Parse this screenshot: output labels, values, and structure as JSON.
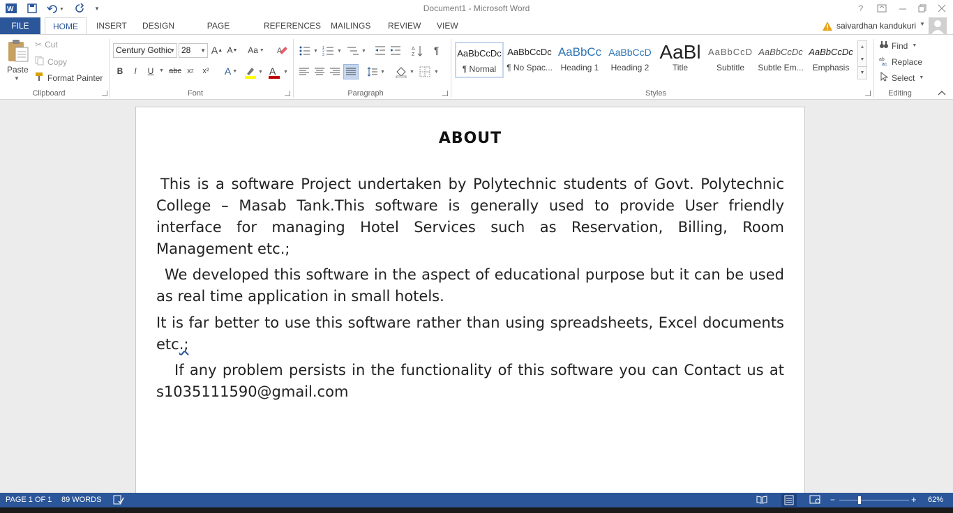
{
  "window": {
    "title": "Document1 - Microsoft Word",
    "user_name": "saivardhan kandukuri",
    "help_label": "?"
  },
  "tabs": {
    "file": "FILE",
    "items": [
      "HOME",
      "INSERT",
      "DESIGN",
      "PAGE LAYOUT",
      "REFERENCES",
      "MAILINGS",
      "REVIEW",
      "VIEW"
    ]
  },
  "clipboard": {
    "paste": "Paste",
    "cut": "Cut",
    "copy": "Copy",
    "format_painter": "Format Painter",
    "group_label": "Clipboard"
  },
  "font": {
    "family": "Century Gothic",
    "size": "28",
    "group_label": "Font",
    "bold": "B",
    "italic": "I",
    "underline": "U",
    "strike": "abc",
    "superscript": "x²",
    "text_effects": "A",
    "font_color": "A",
    "grow": "A",
    "shrink": "A",
    "change_case": "Aa",
    "highlight_color": "#ffff00",
    "font_color_value": "#c00000"
  },
  "paragraph": {
    "group_label": "Paragraph"
  },
  "styles": {
    "group_label": "Styles",
    "items": [
      {
        "sample": "AaBbCcDc",
        "name": "¶ Normal"
      },
      {
        "sample": "AaBbCcDc",
        "name": "¶ No Spac..."
      },
      {
        "sample": "AaBbCc",
        "name": "Heading 1"
      },
      {
        "sample": "AaBbCcD",
        "name": "Heading 2"
      },
      {
        "sample": "AaBl",
        "name": "Title"
      },
      {
        "sample": "AaBbCcD",
        "name": "Subtitle"
      },
      {
        "sample": "AaBbCcDc",
        "name": "Subtle Em..."
      },
      {
        "sample": "AaBbCcDc",
        "name": "Emphasis"
      }
    ]
  },
  "editing": {
    "group_label": "Editing",
    "find": "Find",
    "replace": "Replace",
    "select": "Select"
  },
  "document": {
    "title": "ABOUT",
    "paragraphs": [
      "  This is a software Project undertaken by Polytechnic students of Govt. Polytechnic College – Masab Tank.This software is generally used to provide User friendly interface for managing Hotel Services such as Reservation, Billing, Room Management etc.;",
      " We developed this software in the aspect of educational purpose but it can be used as real time application in small hotels.",
      "It is far better to use this software rather than using spreadsheets, Excel documents etc",
      "   If any problem persists in the functionality of this software you can Contact us at s1035111590@gmail.com"
    ],
    "para3_tail": ".;"
  },
  "status": {
    "page": "PAGE 1 OF 1",
    "words": "89 WORDS",
    "zoom": "62%"
  },
  "colors": {
    "accent": "#2b579a"
  }
}
